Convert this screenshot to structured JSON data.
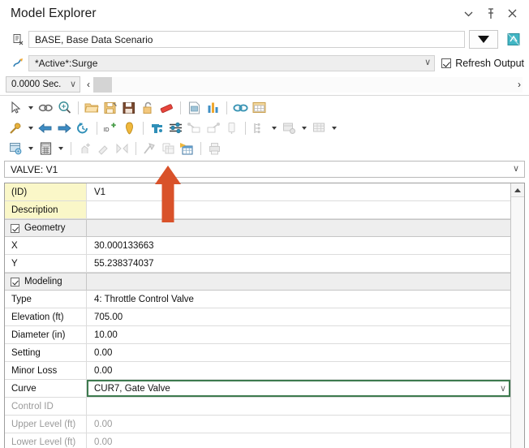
{
  "window": {
    "title": "Model Explorer",
    "controls": [
      {
        "name": "collapse-icon",
        "glyph": "⌄"
      },
      {
        "name": "pin-icon",
        "glyph": "⚐"
      },
      {
        "name": "close-icon",
        "glyph": "✕"
      }
    ]
  },
  "scenario": {
    "icon_name": "scenario-icon",
    "value": "BASE, Base Data Scenario",
    "dropdown_name": "scenario-dropdown-button",
    "compute_icon_name": "compute-icon"
  },
  "active_set": {
    "icon_name": "surge-icon",
    "value": "*Active*:Surge",
    "chevron": "∨",
    "refresh_label": "Refresh Output",
    "refresh_checked": true
  },
  "timebar": {
    "time_value": "0.0000 Sec.",
    "chevron": "∨",
    "prev_glyph": "‹",
    "next_glyph": "›"
  },
  "toolbar": {
    "row1": [
      {
        "name": "select-arrow-icon",
        "type": "cursor"
      },
      {
        "name": "select-dropdown-caret",
        "type": "caret"
      },
      {
        "name": "select-chain-icon",
        "type": "chain-small"
      },
      {
        "name": "zoom-icon",
        "type": "zoom"
      },
      {
        "name": "separator",
        "type": "sep"
      },
      {
        "name": "open-folder-icon",
        "type": "folder"
      },
      {
        "name": "save-as-icon",
        "type": "saveas"
      },
      {
        "name": "save-icon",
        "type": "save"
      },
      {
        "name": "unlock-icon",
        "type": "unlock"
      },
      {
        "name": "eraser-icon",
        "type": "eraser"
      },
      {
        "name": "separator",
        "type": "sep"
      },
      {
        "name": "report-icon",
        "type": "report"
      },
      {
        "name": "graph-icon",
        "type": "graph"
      },
      {
        "name": "separator",
        "type": "sep"
      },
      {
        "name": "link-icon",
        "type": "link"
      },
      {
        "name": "table-window-icon",
        "type": "tablewin"
      }
    ],
    "row2": [
      {
        "name": "tools-hammer-icon",
        "type": "hammer"
      },
      {
        "name": "tools-dropdown-caret",
        "type": "caret"
      },
      {
        "name": "previous-icon",
        "type": "arrow-left"
      },
      {
        "name": "next-icon",
        "type": "arrow-right"
      },
      {
        "name": "history-icon",
        "type": "history"
      },
      {
        "name": "separator",
        "type": "sep"
      },
      {
        "name": "new-id-icon",
        "type": "newid"
      },
      {
        "name": "pin-marker-icon",
        "type": "marker"
      },
      {
        "name": "separator",
        "type": "sep"
      },
      {
        "name": "hydrant-icon",
        "type": "hydrant"
      },
      {
        "name": "settings-sliders-icon",
        "type": "sliders"
      },
      {
        "name": "demand-icon",
        "type": "demand1"
      },
      {
        "name": "pattern-icon",
        "type": "demand2"
      },
      {
        "name": "tank-icon",
        "type": "tank"
      },
      {
        "name": "separator",
        "type": "sep"
      },
      {
        "name": "control-icon",
        "type": "control"
      },
      {
        "name": "control-dropdown-caret",
        "type": "caret"
      },
      {
        "name": "scenario-mgr-icon",
        "type": "scenmgr"
      },
      {
        "name": "scenario-dropdown-caret",
        "type": "caret"
      },
      {
        "name": "grid-view-icon",
        "type": "gridview"
      },
      {
        "name": "grid-dropdown-caret",
        "type": "caret"
      }
    ],
    "row3": [
      {
        "name": "report-options-icon",
        "type": "reportopt"
      },
      {
        "name": "report-options-caret",
        "type": "caret"
      },
      {
        "name": "calculator-icon",
        "type": "calculator"
      },
      {
        "name": "calculator-caret",
        "type": "caret"
      },
      {
        "name": "separator",
        "type": "sep"
      },
      {
        "name": "add-element-icon",
        "type": "addel"
      },
      {
        "name": "edit-element-icon",
        "type": "editel"
      },
      {
        "name": "move-element-icon",
        "type": "moveel"
      },
      {
        "name": "separator",
        "type": "sep"
      },
      {
        "name": "export-icon",
        "type": "export"
      },
      {
        "name": "copy-table-icon",
        "type": "copytab"
      },
      {
        "name": "active-table-icon",
        "type": "acttab"
      },
      {
        "name": "separator",
        "type": "sep"
      },
      {
        "name": "print-icon",
        "type": "print"
      }
    ]
  },
  "element_selector": {
    "value": "VALVE: V1",
    "chevron": "∨"
  },
  "properties": {
    "rows": [
      {
        "name": "(ID)",
        "value": "V1",
        "style": "id"
      },
      {
        "name": "Description",
        "value": "",
        "style": "id"
      },
      {
        "name": "Geometry",
        "value": "",
        "style": "category"
      },
      {
        "name": "X",
        "value": "30.000133663",
        "style": "normal"
      },
      {
        "name": "Y",
        "value": "55.238374037",
        "style": "normal"
      },
      {
        "name": "Modeling",
        "value": "",
        "style": "category"
      },
      {
        "name": "Type",
        "value": "4: Throttle Control Valve",
        "style": "normal"
      },
      {
        "name": "Elevation (ft)",
        "value": "705.00",
        "style": "normal"
      },
      {
        "name": "Diameter (in)",
        "value": "10.00",
        "style": "normal"
      },
      {
        "name": "Setting",
        "value": "0.00",
        "style": "normal"
      },
      {
        "name": "Minor Loss",
        "value": "0.00",
        "style": "normal"
      },
      {
        "name": "Curve",
        "value": "CUR7, Gate Valve",
        "style": "selected"
      },
      {
        "name": "Control ID",
        "value": "",
        "style": "disabled"
      },
      {
        "name": "Upper Level (ft)",
        "value": "0.00",
        "style": "disabled"
      },
      {
        "name": "Lower Level (ft)",
        "value": "0.00",
        "style": "disabled"
      }
    ],
    "scrollbar_up_name": "scroll-up-button"
  },
  "annotation": {
    "name": "red-pointer-arrow",
    "color": "#d9522a"
  }
}
